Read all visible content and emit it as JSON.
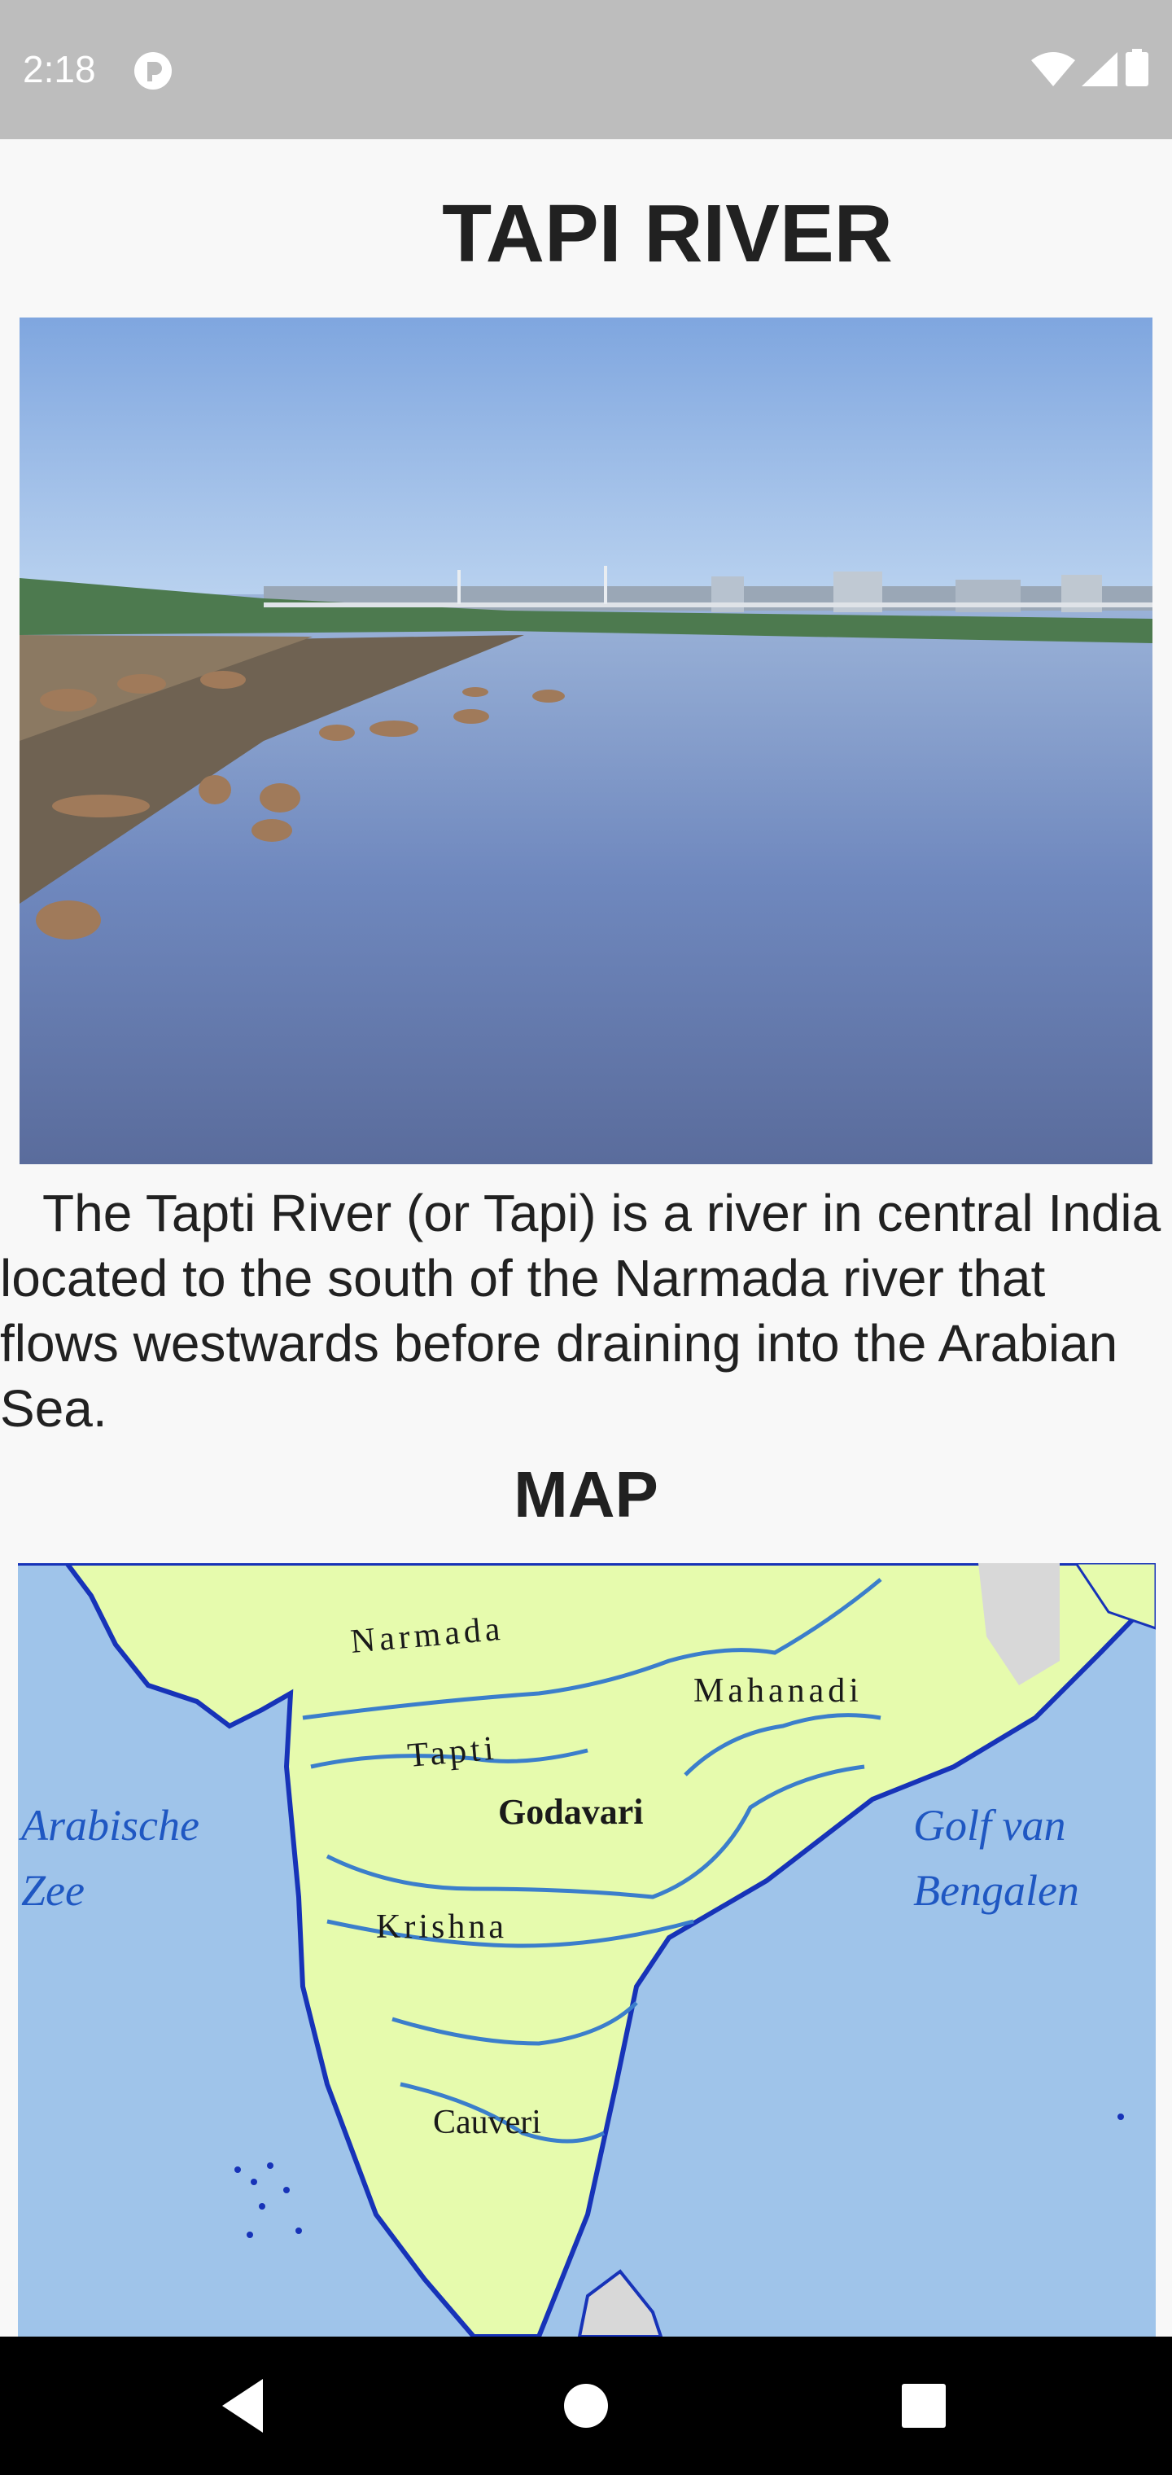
{
  "status_bar": {
    "time": "2:18",
    "icons": [
      "app-notification-icon",
      "wifi-icon",
      "signal-icon",
      "battery-icon"
    ]
  },
  "page": {
    "title": "TAPI RIVER",
    "description": "The Tapti River (or Tapi) is a river in central India located to the south of the Narmada river that flows westwards before draining into the Arabian Sea.",
    "map_heading": "MAP"
  },
  "map": {
    "labels": {
      "narmada": "Narmada",
      "mahanadi": "Mahanadi",
      "tapti": "Tapti",
      "godavari": "Godavari",
      "krishna": "Krishna",
      "cauveri": "Cauveri",
      "arabian_sea_1": "Arabische",
      "arabian_sea_2": "Zee",
      "bay_1": "Golf van",
      "bay_2": "Bengalen"
    },
    "colors": {
      "land": "#e6fbad",
      "sea": "#9fc4ea",
      "river": "#3b7ecb",
      "coast": "#1733b8"
    }
  },
  "nav_bar": {
    "buttons": [
      "back-icon",
      "home-icon",
      "recents-icon"
    ]
  }
}
